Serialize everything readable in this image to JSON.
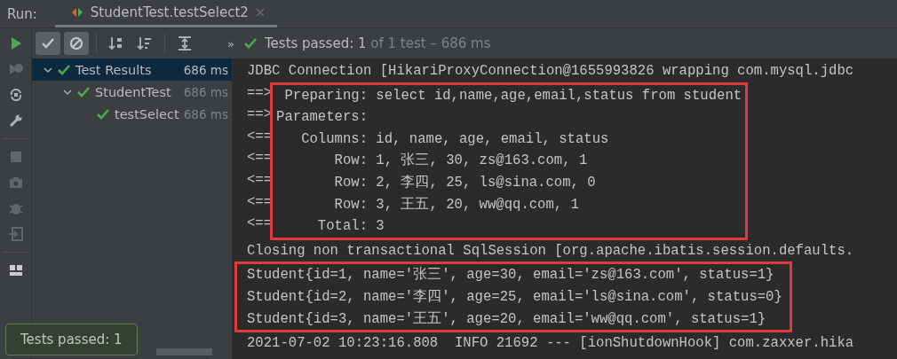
{
  "run_bar": {
    "label": "Run:",
    "tab": {
      "title": "StudentTest.testSelect2",
      "selected": true
    }
  },
  "toolbar": {
    "buttons": [
      {
        "kind": "show-passed",
        "pressed": true
      },
      {
        "kind": "show-ignored",
        "pressed": true
      },
      {
        "kind": "sort-alpha",
        "pressed": false
      },
      {
        "kind": "sort-duration",
        "pressed": false
      },
      {
        "kind": "expand",
        "pressed": false
      }
    ],
    "more": "»",
    "status": {
      "main": "Tests passed: 1",
      "detail": " of 1 test – 686 ms"
    }
  },
  "side_tools": [
    {
      "kind": "run",
      "disabled": false
    },
    {
      "kind": "rerun",
      "disabled": true
    },
    {
      "kind": "toggle",
      "disabled": false
    },
    {
      "kind": "wrench",
      "disabled": false
    },
    {
      "kind": "stop",
      "disabled": true
    },
    {
      "kind": "camera",
      "disabled": true
    },
    {
      "kind": "bug",
      "disabled": true
    },
    {
      "kind": "exit",
      "disabled": true
    },
    {
      "kind": "layout",
      "disabled": false
    }
  ],
  "tree": [
    {
      "label": "Test Results",
      "duration": "686 ms",
      "expanded": true,
      "selected": true,
      "children": [
        {
          "label": "StudentTest",
          "duration": "686 ms",
          "expanded": true,
          "selected": false,
          "children": [
            {
              "label": "testSelect",
              "duration": "686 ms",
              "selected": false
            }
          ]
        }
      ]
    }
  ],
  "console": [
    {
      "kind": "plain",
      "lines": [
        {
          "text": "JDBC Connection [HikariProxyConnection@1655993826 wrapping com.mysql.jdbc"
        }
      ]
    },
    {
      "kind": "framed_text",
      "lines": [
        {
          "prefix": "==>",
          "text": " Preparing: select id,name,age,email,status from student"
        },
        {
          "prefix": "==>",
          "text": "Parameters: "
        },
        {
          "prefix": "<==",
          "text": "   Columns: id, name, age, email, status"
        },
        {
          "prefix": "<==",
          "text": "       Row: 1, 张三, 30, zs@163.com, 1"
        },
        {
          "prefix": "<==",
          "text": "       Row: 2, 李四, 25, ls@sina.com, 0"
        },
        {
          "prefix": "<==",
          "text": "       Row: 3, 王五, 20, ww@qq.com, 1"
        },
        {
          "prefix": "<==",
          "text": "     Total: 3"
        }
      ]
    },
    {
      "kind": "plain",
      "lines": [
        {
          "text": "Closing non transactional SqlSession [org.apache.ibatis.session.defaults."
        }
      ]
    },
    {
      "kind": "framed_line",
      "lines": [
        {
          "text": "Student{id=1, name='张三', age=30, email='zs@163.com', status=1}"
        },
        {
          "text": "Student{id=2, name='李四', age=25, email='ls@sina.com', status=0}"
        },
        {
          "text": "Student{id=3, name='王五', age=20, email='ww@qq.com', status=1}"
        }
      ]
    },
    {
      "kind": "plain",
      "lines": [
        {
          "text": "2021-07-02 10:23:16.808  INFO 21692 --- [ionShutdownHook] com.zaxxer.hika"
        }
      ]
    }
  ],
  "notification": {
    "text": "Tests passed: 1"
  }
}
